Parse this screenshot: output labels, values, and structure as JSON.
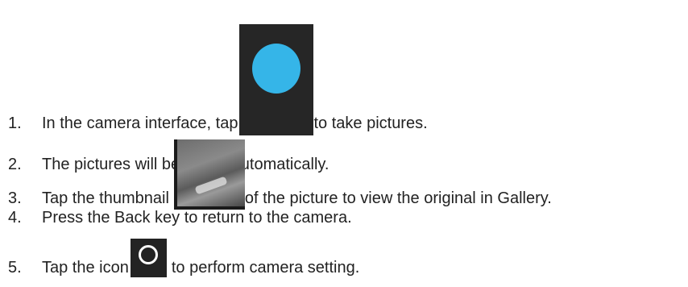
{
  "steps": [
    {
      "number": "1.",
      "text_before": "In the camera interface, tap ",
      "icon": "shutter-button-icon",
      "text_after": "to take pictures."
    },
    {
      "number": "2.",
      "text": "The pictures will be saved automatically."
    },
    {
      "number": "3.",
      "text_before": "Tap the thumbnail ",
      "icon": "gallery-thumbnail-icon",
      "text_after": "of the picture to view the original in Gallery."
    },
    {
      "number": "4.",
      "text": "Press the Back key to return to the camera."
    },
    {
      "number": "5.",
      "text_before": "Tap the icon",
      "icon": "camera-settings-icon",
      "text_after": " to perform camera setting."
    }
  ],
  "colors": {
    "shutter_dot": "#35b5e8",
    "icon_background": "#262626",
    "text": "#222222"
  }
}
